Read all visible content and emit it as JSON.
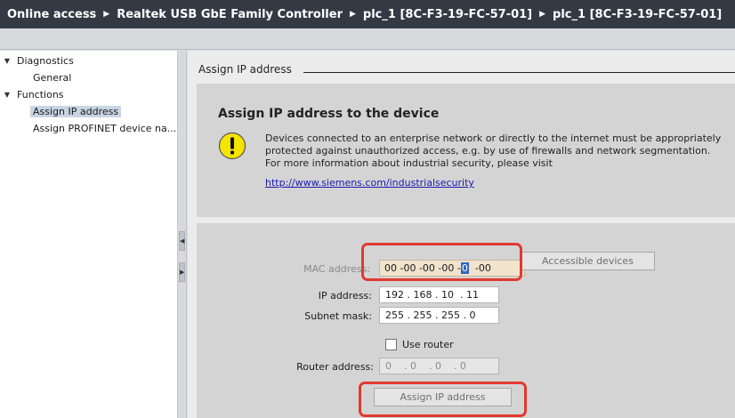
{
  "titlebar": {
    "crumbs": [
      "Online access",
      "Realtek USB GbE Family Controller",
      "plc_1 [8C-F3-19-FC-57-01]",
      "plc_1 [8C-F3-19-FC-57-01]"
    ]
  },
  "tree": {
    "diagnostics": "Diagnostics",
    "general": "General",
    "functions": "Functions",
    "assign_ip": "Assign IP address",
    "assign_profinet": "Assign PROFINET device na..."
  },
  "section": {
    "header": "Assign IP address"
  },
  "info": {
    "title": "Assign IP address to the device",
    "warning": "Devices connected to an enterprise network or directly to the internet must be appropriately protected against unauthorized access, e.g. by use of firewalls and network segmentation. For more information about industrial security, please visit",
    "link": "http://www.siemens.com/industrialsecurity",
    "icon": "warning-icon",
    "warning_color": "#f5e400"
  },
  "form": {
    "mac_label": "MAC address:",
    "mac_before": "00 -00 -00 -00 -",
    "mac_selected": "0",
    "mac_after": "  -00",
    "accessible_devices": "Accessible devices",
    "ip_label": "IP address:",
    "ip_value": "192 . 168 . 10  . 11",
    "subnet_label": "Subnet mask:",
    "subnet_value": "255 . 255 . 255 . 0",
    "use_router": "Use router",
    "router_label": "Router address:",
    "router_value": "0    . 0    . 0    . 0",
    "assign_button": "Assign IP address"
  },
  "colors": {
    "highlight": "#e03a2f",
    "titlebar": "#333a44"
  }
}
